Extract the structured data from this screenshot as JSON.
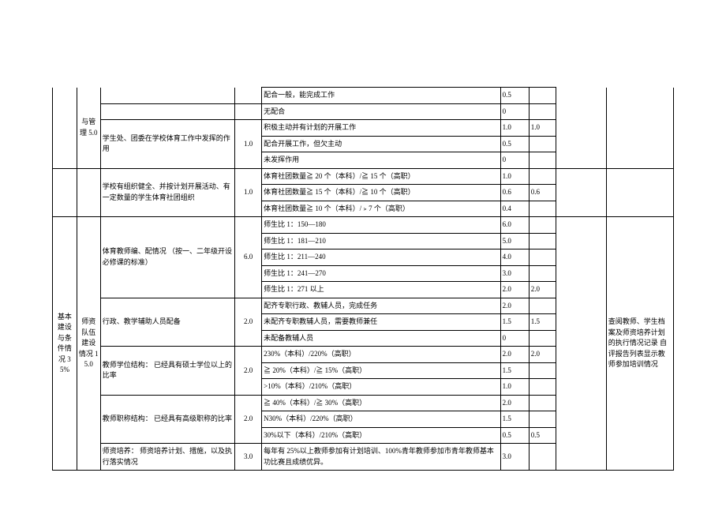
{
  "col1": {
    "basic": "基本建设与条件情况\n\n35%"
  },
  "col2": {
    "guanli": "与管理\n5.0",
    "shizi": "师资队伍建设情况\n15.0"
  },
  "indicators": {
    "xueshengchu": "学生处、团委在学校体育工作中发挥的作用",
    "xueshengchu_w": "1.0",
    "shetuan": "学校有组织健全、并按计划开展活动、有一定数量的学生体育社团组织",
    "shetuan_w": "1.0",
    "jiaoshibian": "体育教师编、配情况\n（按一、二年级开设必修课的标准）",
    "jiaoshibian_w": "6.0",
    "xingzheng": "行政、教学辅助人员配备",
    "xingzheng_w": "2.0",
    "xuewei": "教师学位结构：\n已经具有硕士学位以上的比率",
    "xuewei_w": "2.0",
    "zhicheng": "教师职称结构：\n已经具有高级职称的比率",
    "zhicheng_w": "2.0",
    "peiyang": "师资培养：\n师资培养计划、措施，以及执行落实情况",
    "peiyang_w": "3.0"
  },
  "rows": {
    "r1": {
      "desc": "配合一般，能完成工作",
      "pt": "0.5",
      "score": ""
    },
    "r2": {
      "desc": "无配合",
      "pt": "0",
      "score": ""
    },
    "r3": {
      "desc": "积极主动并有计划的开展工作",
      "pt": "1.0",
      "score": "1.0"
    },
    "r4": {
      "desc": "配合开展工作，但欠主动",
      "pt": "0.5",
      "score": ""
    },
    "r5": {
      "desc": "未发挥作用",
      "pt": "0",
      "score": ""
    },
    "r6": {
      "desc": "体育社团数量≧ 20 个（本科）/≧ 15 个（高职）",
      "pt": "1.0",
      "score": ""
    },
    "r7": {
      "desc": "体育社团数量≧ 15 个（本科）/≧ 10 个（高职）",
      "pt": "0.6",
      "score": "0.6"
    },
    "r8": {
      "desc": "体育社团数量≧ 10 个（本科）/﹥7 个（高职）",
      "pt": "0.4",
      "score": ""
    },
    "r9": {
      "desc": "师生比 1：150—180",
      "pt": "6.0",
      "score": ""
    },
    "r10": {
      "desc": "师生比 1：181—210",
      "pt": "5.0",
      "score": ""
    },
    "r11": {
      "desc": "师生比 1：211—240",
      "pt": "4.0",
      "score": ""
    },
    "r12": {
      "desc": "师生比 1：241—270",
      "pt": "3.0",
      "score": ""
    },
    "r13": {
      "desc": "师生比 1：271 以上",
      "pt": "2.0",
      "score": "2.0"
    },
    "r14": {
      "desc": "配齐专职行政、教辅人员，完成任务",
      "pt": "2.0",
      "score": ""
    },
    "r15": {
      "desc": "未配齐专职教辅人员，需要教师兼任",
      "pt": "1.5",
      "score": "1.5"
    },
    "r16": {
      "desc": "未配备教辅人员",
      "pt": "0",
      "score": ""
    },
    "r17": {
      "desc": "230%（本科）/220%（高职）",
      "pt": "2.0",
      "score": "2.0"
    },
    "r18": {
      "desc": "≧ 20%（本科）/≧ 15%（高职）",
      "pt": "1.5",
      "score": ""
    },
    "r19": {
      "desc": ">10%（本科）/210%（高职）",
      "pt": "1.0",
      "score": ""
    },
    "r20": {
      "desc": "≧ 40%（本科）/≧ 30%（高职）",
      "pt": "2.0",
      "score": ""
    },
    "r21": {
      "desc": "N30%（本科）/220%（高职）",
      "pt": "1.5",
      "score": ""
    },
    "r22": {
      "desc": "30%以下（本科）/210%（高职）",
      "pt": "0.5",
      "score": "0.5"
    },
    "r23": {
      "desc": "每年有 25%以上教师参加有计划培训、100%青年教师参加市青年教师基本功比赛且成绩优异。",
      "pt": "3.0",
      "score": ""
    }
  },
  "notes": {
    "n1": "",
    "n2": "",
    "n3": "查阅教师、学生档案及师资培养计划的执行情况记录\n\n自评报告列表显示教师参加培训情况"
  }
}
